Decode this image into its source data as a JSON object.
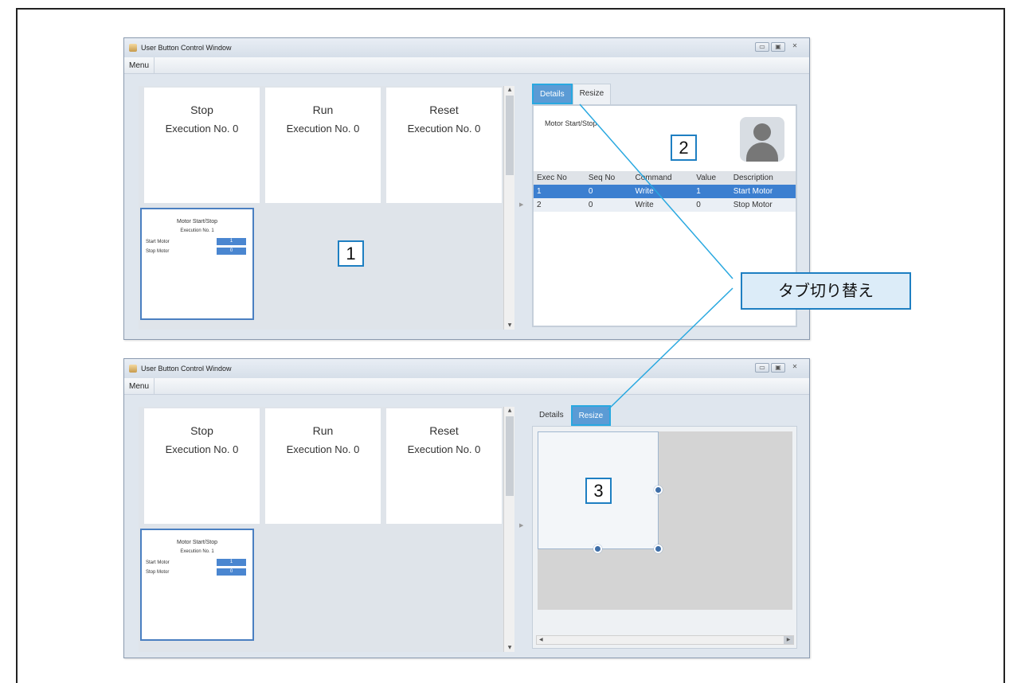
{
  "window": {
    "title": "User Button Control Window",
    "menu_label": "Menu",
    "controls": {
      "minimize": "▭",
      "maximize": "▣",
      "close": "✕"
    }
  },
  "button_cards": [
    {
      "title": "Stop",
      "execution": "Execution No.  0"
    },
    {
      "title": "Run",
      "execution": "Execution No.  0"
    },
    {
      "title": "Reset",
      "execution": "Execution No.  0"
    }
  ],
  "motor_card": {
    "title": "Motor Start/Stop",
    "execution": "Execution No.  1",
    "rows": [
      {
        "label": "Start Motor",
        "value": "1"
      },
      {
        "label": "Stop Motor",
        "value": "0"
      }
    ]
  },
  "tabs": {
    "details": "Details",
    "resize": "Resize"
  },
  "details": {
    "header": "Motor Start/Stop",
    "columns": [
      "Exec No",
      "Seq No",
      "Command",
      "Value",
      "Description"
    ],
    "rows": [
      [
        "1",
        "0",
        "Write",
        "1",
        "Start Motor"
      ],
      [
        "2",
        "0",
        "Write",
        "0",
        "Stop Motor"
      ]
    ]
  },
  "callouts": {
    "one": "1",
    "two": "2",
    "three": "3"
  },
  "annotation": {
    "tab_switch": "タブ切り替え"
  },
  "colors": {
    "accent": "#5b9bd5",
    "callout_border": "#1e7fc2",
    "selected_row": "#3c7fd0"
  }
}
